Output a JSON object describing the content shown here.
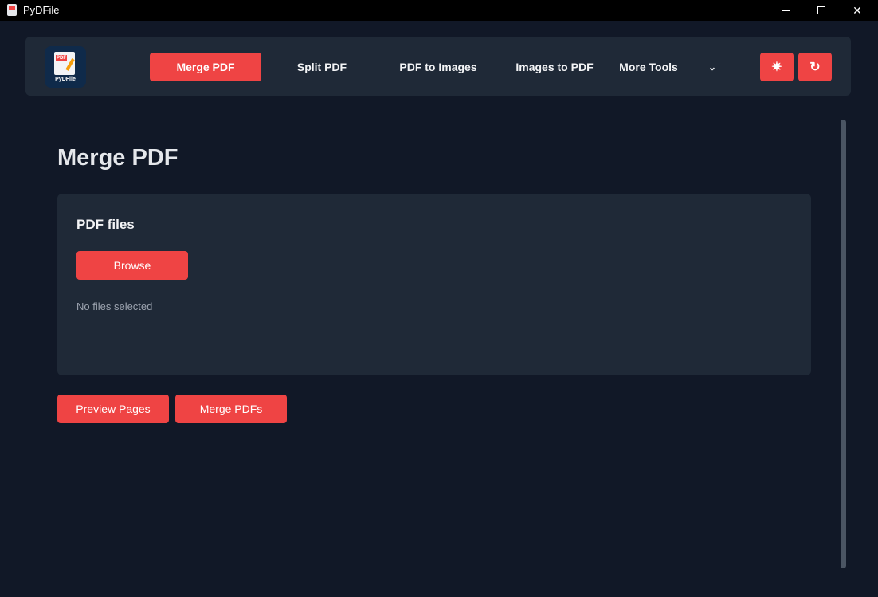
{
  "window": {
    "title": "PyDFile",
    "controls": {
      "minimize": "minimize-icon",
      "maximize": "maximize-icon",
      "close": "✕"
    }
  },
  "logo": {
    "badge": "PDF",
    "label": "PyDFile"
  },
  "nav": {
    "items": [
      {
        "label": "Merge PDF",
        "active": true
      },
      {
        "label": "Split PDF",
        "active": false
      },
      {
        "label": "PDF to Images",
        "active": false
      },
      {
        "label": "Images to PDF",
        "active": false
      },
      {
        "label": "More Tools",
        "active": false
      }
    ],
    "chevron": "⌄",
    "theme_icon": "✷",
    "refresh_icon": "↻"
  },
  "main": {
    "title": "Merge PDF",
    "card": {
      "label": "PDF files",
      "browse_label": "Browse",
      "status": "No files selected"
    },
    "actions": {
      "preview_label": "Preview Pages",
      "merge_label": "Merge PDFs"
    }
  },
  "colors": {
    "background": "#111827",
    "panel": "#1f2937",
    "accent": "#ef4444",
    "titlebar": "#000000"
  }
}
